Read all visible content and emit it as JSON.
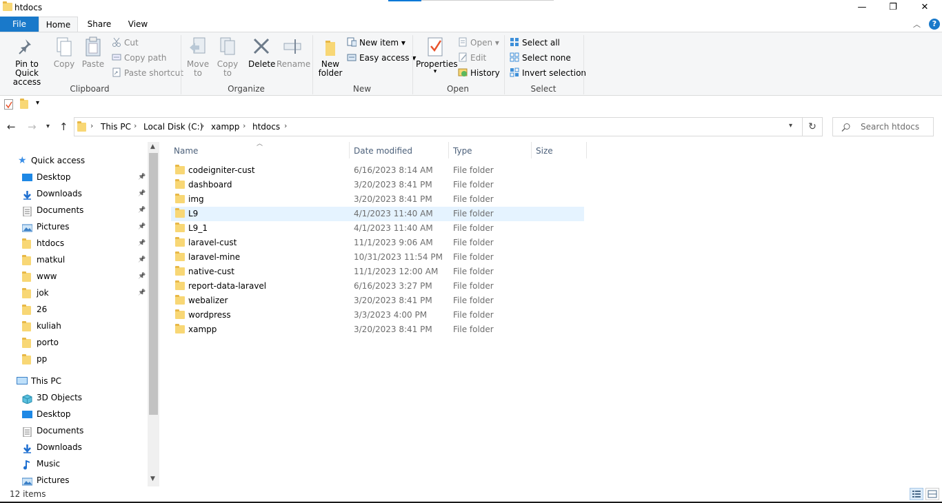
{
  "window": {
    "title": "htdocs",
    "minimize": "—",
    "maximize": "❐",
    "close": "✕"
  },
  "tabs": {
    "file": "File",
    "home": "Home",
    "share": "Share",
    "view": "View"
  },
  "ribbon": {
    "clipboard": {
      "label": "Clipboard",
      "pin": "Pin to Quick access",
      "copy": "Copy",
      "paste": "Paste",
      "cut": "Cut",
      "copy_path": "Copy path",
      "paste_shortcut": "Paste shortcut"
    },
    "organize": {
      "label": "Organize",
      "move_to": "Move to",
      "copy_to": "Copy to",
      "delete": "Delete",
      "rename": "Rename"
    },
    "new": {
      "label": "New",
      "new_folder": "New folder",
      "new_item": "New item",
      "easy_access": "Easy access"
    },
    "open": {
      "label": "Open",
      "properties": "Properties",
      "open": "Open",
      "edit": "Edit",
      "history": "History"
    },
    "select": {
      "label": "Select",
      "select_all": "Select all",
      "select_none": "Select none",
      "invert": "Invert selection"
    }
  },
  "address": {
    "segments": [
      "This PC",
      "Local Disk (C:)",
      "xampp",
      "htdocs"
    ],
    "search_placeholder": "Search htdocs"
  },
  "nav": {
    "quick_access": "Quick access",
    "quick_items": [
      {
        "label": "Desktop",
        "pinned": true
      },
      {
        "label": "Downloads",
        "pinned": true
      },
      {
        "label": "Documents",
        "pinned": true
      },
      {
        "label": "Pictures",
        "pinned": true
      },
      {
        "label": "htdocs",
        "pinned": true
      },
      {
        "label": "matkul",
        "pinned": true
      },
      {
        "label": "www",
        "pinned": true
      },
      {
        "label": "jok",
        "pinned": true
      },
      {
        "label": "26",
        "pinned": false
      },
      {
        "label": "kuliah",
        "pinned": false
      },
      {
        "label": "porto",
        "pinned": false
      },
      {
        "label": "pp",
        "pinned": false
      }
    ],
    "this_pc": "This PC",
    "pc_items": [
      "3D Objects",
      "Desktop",
      "Documents",
      "Downloads",
      "Music",
      "Pictures"
    ]
  },
  "columns": {
    "name": "Name",
    "date": "Date modified",
    "type": "Type",
    "size": "Size"
  },
  "files": [
    {
      "name": "codeigniter-cust",
      "date": "6/16/2023 8:14 AM",
      "type": "File folder"
    },
    {
      "name": "dashboard",
      "date": "3/20/2023 8:41 PM",
      "type": "File folder"
    },
    {
      "name": "img",
      "date": "3/20/2023 8:41 PM",
      "type": "File folder"
    },
    {
      "name": "L9",
      "date": "4/1/2023 11:40 AM",
      "type": "File folder"
    },
    {
      "name": "L9_1",
      "date": "4/1/2023 11:40 AM",
      "type": "File folder"
    },
    {
      "name": "laravel-cust",
      "date": "11/1/2023 9:06 AM",
      "type": "File folder"
    },
    {
      "name": "laravel-mine",
      "date": "10/31/2023 11:54 PM",
      "type": "File folder"
    },
    {
      "name": "native-cust",
      "date": "11/1/2023 12:00 AM",
      "type": "File folder"
    },
    {
      "name": "report-data-laravel",
      "date": "6/16/2023 3:27 PM",
      "type": "File folder"
    },
    {
      "name": "webalizer",
      "date": "3/20/2023 8:41 PM",
      "type": "File folder"
    },
    {
      "name": "wordpress",
      "date": "3/3/2023 4:00 PM",
      "type": "File folder"
    },
    {
      "name": "xampp",
      "date": "3/20/2023 8:41 PM",
      "type": "File folder"
    }
  ],
  "selected_row": "L9",
  "status": {
    "items": "12 items"
  },
  "colors": {
    "accent": "#1979ca",
    "selection": "#e5f3ff",
    "folder": "#f8d775"
  }
}
